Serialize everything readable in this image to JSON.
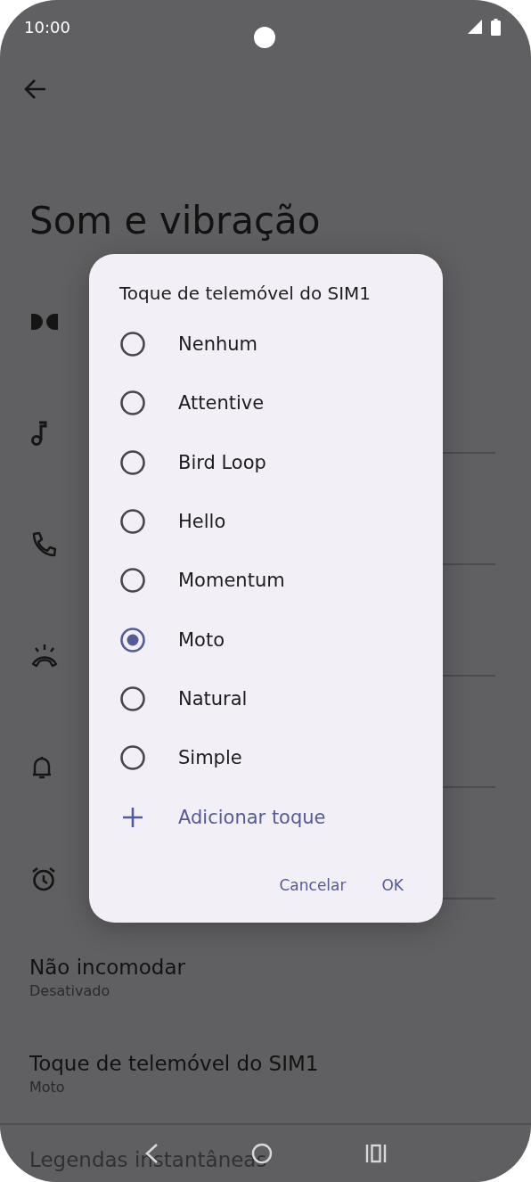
{
  "status_bar": {
    "time": "10:00"
  },
  "page": {
    "title": "Som e vibração",
    "rows": [
      {
        "title": "Não incomodar",
        "subtitle": "Desativado"
      },
      {
        "title": "Toque de telemóvel do SIM1",
        "subtitle": "Moto"
      },
      {
        "title": "Legendas instantâneas"
      }
    ]
  },
  "dialog": {
    "title": "Toque de telemóvel do SIM1",
    "options": [
      {
        "label": "Nenhum",
        "selected": false
      },
      {
        "label": "Attentive",
        "selected": false
      },
      {
        "label": "Bird Loop",
        "selected": false
      },
      {
        "label": "Hello",
        "selected": false
      },
      {
        "label": "Momentum",
        "selected": false
      },
      {
        "label": "Moto",
        "selected": true
      },
      {
        "label": "Natural",
        "selected": false
      },
      {
        "label": "Simple",
        "selected": false
      }
    ],
    "add_action": "Adicionar toque",
    "buttons": [
      "Cancelar",
      "OK"
    ]
  }
}
